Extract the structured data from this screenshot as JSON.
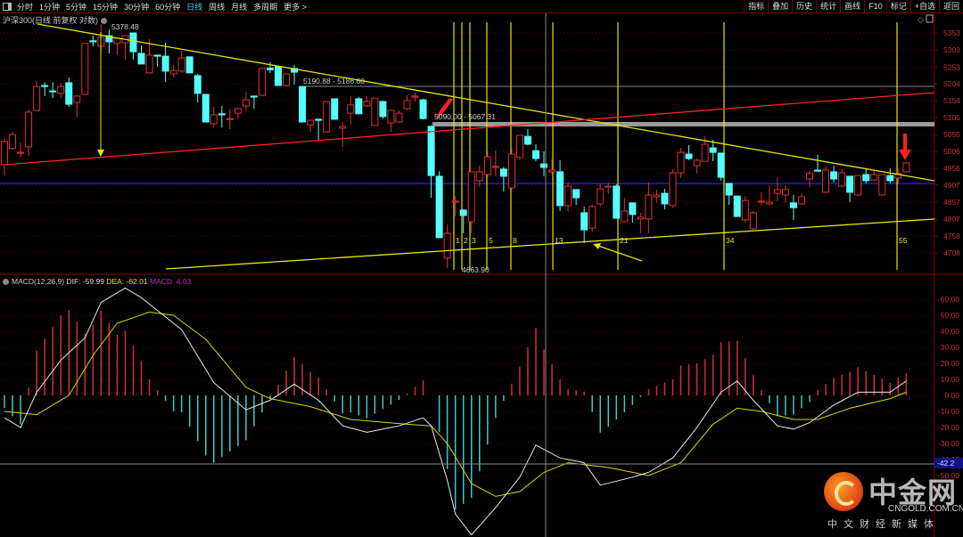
{
  "toolbar": {
    "left_items": [
      "分时",
      "1分钟",
      "5分钟",
      "15分钟",
      "30分钟",
      "60分钟",
      "日线",
      "周线",
      "月线",
      "多周期",
      "更多 >"
    ],
    "active": "日线",
    "right_items": [
      "指标",
      "叠加",
      "历史",
      "统计",
      "画线",
      "F10",
      "标记",
      "+自选",
      "返回"
    ]
  },
  "header": {
    "title": "沪深300(日线 前复权 对数)"
  },
  "macd_header": {
    "name": "MACD(12,26,9)",
    "dif": "DIF: -59.99",
    "dea": "DEA: -62.01",
    "macd": "MACD: 4.03"
  },
  "price_axis": [
    "5353",
    "5303",
    "5253",
    "5204",
    "5154",
    "5105",
    "5055",
    "5006",
    "4956",
    "4907",
    "4857",
    "4807",
    "4758",
    "4708"
  ],
  "macd_axis": [
    "60.00",
    "50.00",
    "40.00",
    "30.00",
    "20.00",
    "10.00",
    "0.00",
    "-10.00",
    "-20.00",
    "-30.00",
    "-40.00",
    "-50.00"
  ],
  "crosshair_value": "-42.2",
  "annotations": {
    "high": "5378.48",
    "low": "4663.90",
    "range1": "5190.88 - 5186.60",
    "range2": "5090.00 - 5067.31"
  },
  "fib_labels": [
    "1",
    "2",
    "3",
    "5",
    "8",
    "13",
    "21",
    "34",
    "55"
  ],
  "logo": {
    "name": "中金网",
    "url": "CNGOLD.COM.CN",
    "slogan": "中文财经新媒体"
  },
  "colors": {
    "up": "#e03030",
    "down": "#54ffff",
    "trend": "#e6e600",
    "support": "#ff2020",
    "blue_line": "#2020ff",
    "dif": "#e8e8e8",
    "dea": "#d8d800"
  },
  "chart_data": [
    {
      "type": "candlestick",
      "title": "沪深300(日线 前复权 对数)",
      "ylim": [
        4663.9,
        5378.48
      ],
      "fields": [
        "open",
        "high",
        "low",
        "close"
      ],
      "candles": [
        [
          4967,
          5042,
          4935,
          5035
        ],
        [
          5014,
          5063,
          5011,
          5055
        ],
        [
          5001,
          5032,
          4988,
          5003
        ],
        [
          5019,
          5129,
          4993,
          5121
        ],
        [
          5126,
          5212,
          5123,
          5196
        ],
        [
          5199,
          5209,
          5168,
          5196
        ],
        [
          5183,
          5209,
          5162,
          5181
        ],
        [
          5176,
          5207,
          5162,
          5196
        ],
        [
          5207,
          5223,
          5136,
          5144
        ],
        [
          5149,
          5170,
          5105,
          5168
        ],
        [
          5173,
          5324,
          5173,
          5322
        ],
        [
          5330,
          5345,
          5314,
          5327
        ],
        [
          5314,
          5378.48,
          5293,
          5340
        ],
        [
          5345,
          5363,
          5293,
          5327
        ],
        [
          5322,
          5337,
          5288,
          5337
        ],
        [
          5324,
          5345,
          5275,
          5345
        ],
        [
          5353,
          5353,
          5275,
          5298
        ],
        [
          5293,
          5316,
          5262,
          5262
        ],
        [
          5236,
          5335,
          5233,
          5288
        ],
        [
          5288,
          5288,
          5254,
          5285
        ],
        [
          5285,
          5324,
          5209,
          5241
        ],
        [
          5233,
          5259,
          5223,
          5243
        ],
        [
          5241,
          5301,
          5236,
          5280
        ],
        [
          5283,
          5283,
          5236,
          5236
        ],
        [
          5228,
          5233,
          5149,
          5176
        ],
        [
          5173,
          5173,
          5092,
          5092
        ],
        [
          5087,
          5136,
          5076,
          5113
        ],
        [
          5116,
          5139,
          5076,
          5113
        ],
        [
          5100,
          5131,
          5071,
          5102
        ],
        [
          5118,
          5131,
          5100,
          5131
        ],
        [
          5139,
          5181,
          5123,
          5157
        ],
        [
          5168,
          5168,
          5131,
          5165
        ],
        [
          5170,
          5249,
          5170,
          5249
        ],
        [
          5250,
          5267,
          5236,
          5245
        ],
        [
          5254,
          5254,
          5199,
          5199
        ],
        [
          5199,
          5233,
          5196,
          5233
        ],
        [
          5249,
          5259,
          5202,
          5238
        ],
        [
          5196,
          5196,
          5092,
          5092
        ],
        [
          5084,
          5097,
          5063,
          5097
        ],
        [
          5100,
          5102,
          5040,
          5097
        ],
        [
          5063,
          5152,
          5063,
          5152
        ],
        [
          5160,
          5160,
          5100,
          5100
        ],
        [
          5074,
          5092,
          5019,
          5079
        ],
        [
          5118,
          5168,
          5084,
          5142
        ],
        [
          5160,
          5165,
          5116,
          5116
        ],
        [
          5139,
          5168,
          5136,
          5152
        ],
        [
          5082,
          5162,
          5082,
          5162
        ],
        [
          5152,
          5155,
          5102,
          5108
        ],
        [
          5089,
          5126,
          5063,
          5126
        ],
        [
          5092,
          5126,
          5089,
          5118
        ],
        [
          5131,
          5170,
          5126,
          5155
        ],
        [
          5165,
          5178,
          5152,
          5168
        ],
        [
          5157,
          5160,
          5100,
          5102
        ],
        [
          5079,
          5082,
          4870,
          4935
        ],
        [
          4933,
          4948,
          4753,
          4753
        ],
        [
          4693,
          4792,
          4663.9,
          4766
        ],
        [
          4857,
          4875,
          4815,
          4860
        ],
        [
          4834,
          4836,
          4766,
          4818
        ],
        [
          4800,
          4946,
          4766,
          4946
        ],
        [
          4920,
          4964,
          4901,
          4946
        ],
        [
          4938,
          5006,
          4930,
          4990
        ],
        [
          4959,
          5008,
          4933,
          4962
        ],
        [
          4954,
          4960,
          4888,
          4933
        ],
        [
          4899,
          5014,
          4894,
          4998
        ],
        [
          4988,
          5053,
          4980,
          5053
        ],
        [
          5050,
          5071,
          5024,
          5027
        ],
        [
          5008,
          5027,
          4977,
          4985
        ],
        [
          4969,
          5006,
          4933,
          4959
        ],
        [
          4946,
          4983,
          4941,
          4951
        ],
        [
          4946,
          4980,
          4831,
          4847
        ],
        [
          4847,
          4915,
          4829,
          4904
        ],
        [
          4894,
          4894,
          4849,
          4870
        ],
        [
          4826,
          4844,
          4737,
          4776
        ],
        [
          4781,
          4849,
          4771,
          4844
        ],
        [
          4852,
          4910,
          4844,
          4896
        ],
        [
          4901,
          4915,
          4881,
          4904
        ],
        [
          4904,
          4910,
          4810,
          4810
        ],
        [
          4800,
          4870,
          4797,
          4831
        ],
        [
          4855,
          4855,
          4797,
          4821
        ],
        [
          4808,
          4826,
          4766,
          4813
        ],
        [
          4808,
          4915,
          4766,
          4878
        ],
        [
          4873,
          4894,
          4855,
          4878
        ],
        [
          4883,
          4896,
          4836,
          4852
        ],
        [
          4847,
          4954,
          4841,
          4943
        ],
        [
          4943,
          5016,
          4928,
          5003
        ],
        [
          4998,
          5024,
          4980,
          4985
        ],
        [
          4964,
          4985,
          4941,
          4980
        ],
        [
          4977,
          5050,
          4977,
          5027
        ],
        [
          5016,
          5040,
          4977,
          5003
        ],
        [
          5001,
          5001,
          4920,
          4930
        ],
        [
          4912,
          4912,
          4849,
          4878
        ],
        [
          4875,
          4875,
          4815,
          4815
        ],
        [
          4805,
          4875,
          4797,
          4862
        ],
        [
          4779,
          4831,
          4776,
          4826
        ],
        [
          4857,
          4886,
          4847,
          4860
        ],
        [
          4852,
          4907,
          4849,
          4857
        ],
        [
          4883,
          4930,
          4860,
          4894
        ],
        [
          4878,
          4907,
          4855,
          4894
        ],
        [
          4855,
          4878,
          4805,
          4841
        ],
        [
          4852,
          4883,
          4849,
          4873
        ],
        [
          4925,
          4948,
          4901,
          4941
        ],
        [
          4951,
          4996,
          4946,
          4948
        ],
        [
          4886,
          4962,
          4883,
          4951
        ],
        [
          4946,
          4964,
          4915,
          4925
        ],
        [
          4904,
          4954,
          4901,
          4943
        ],
        [
          4933,
          4933,
          4857,
          4886
        ],
        [
          4878,
          4935,
          4875,
          4935
        ],
        [
          4938,
          4954,
          4912,
          4920
        ],
        [
          4922,
          4948,
          4922,
          4938
        ],
        [
          4878,
          4938,
          4878,
          4938
        ],
        [
          4935,
          4956,
          4912,
          4920
        ],
        [
          4928,
          4956,
          4912,
          4941
        ],
        [
          4946,
          4972,
          4946,
          4972
        ]
      ]
    },
    {
      "type": "line",
      "title": "MACD(12,26,9)",
      "ylim": [
        -50,
        65
      ],
      "series": [
        {
          "name": "DIF",
          "keypoints": [
            [
              0,
              -14
            ],
            [
              2,
              -20
            ],
            [
              4,
              2
            ],
            [
              7,
              22
            ],
            [
              10,
              36
            ],
            [
              12,
              58
            ],
            [
              15,
              67
            ],
            [
              17,
              61
            ],
            [
              22,
              41
            ],
            [
              26,
              8
            ],
            [
              30,
              -9
            ],
            [
              33,
              -3
            ],
            [
              36,
              7
            ],
            [
              39,
              -3
            ],
            [
              42,
              -19
            ],
            [
              45,
              -23
            ],
            [
              49,
              -19
            ],
            [
              52,
              -14
            ],
            [
              53,
              -19
            ],
            [
              55,
              -53
            ],
            [
              56,
              -74
            ],
            [
              58,
              -87
            ],
            [
              61,
              -70
            ],
            [
              64,
              -51
            ],
            [
              66,
              -31
            ],
            [
              69,
              -39
            ],
            [
              72,
              -42
            ],
            [
              74,
              -56
            ],
            [
              78,
              -51
            ],
            [
              80,
              -48
            ],
            [
              83,
              -39
            ],
            [
              86,
              -20
            ],
            [
              89,
              2
            ],
            [
              91,
              9
            ],
            [
              93,
              -3
            ],
            [
              96,
              -19
            ],
            [
              98,
              -21
            ],
            [
              100,
              -17
            ],
            [
              103,
              -6
            ],
            [
              106,
              2
            ],
            [
              110,
              2
            ],
            [
              112,
              9
            ]
          ]
        },
        {
          "name": "DEA",
          "keypoints": [
            [
              0,
              -10
            ],
            [
              4,
              -12
            ],
            [
              8,
              0
            ],
            [
              11,
              25
            ],
            [
              14,
              45
            ],
            [
              18,
              52
            ],
            [
              21,
              50
            ],
            [
              25,
              35
            ],
            [
              30,
              5
            ],
            [
              33,
              -2
            ],
            [
              38,
              -7
            ],
            [
              43,
              -15
            ],
            [
              50,
              -18
            ],
            [
              53,
              -19
            ],
            [
              55,
              -30
            ],
            [
              58,
              -55
            ],
            [
              61,
              -63
            ],
            [
              64,
              -60
            ],
            [
              67,
              -48
            ],
            [
              70,
              -42
            ],
            [
              75,
              -45
            ],
            [
              80,
              -50
            ],
            [
              84,
              -42
            ],
            [
              88,
              -18
            ],
            [
              91,
              -8
            ],
            [
              94,
              -10
            ],
            [
              98,
              -15
            ],
            [
              101,
              -15
            ],
            [
              105,
              -8
            ],
            [
              110,
              -2
            ],
            [
              112,
              2
            ]
          ]
        }
      ],
      "histogram": "MACD = 2 × (DIF − DEA)"
    }
  ]
}
